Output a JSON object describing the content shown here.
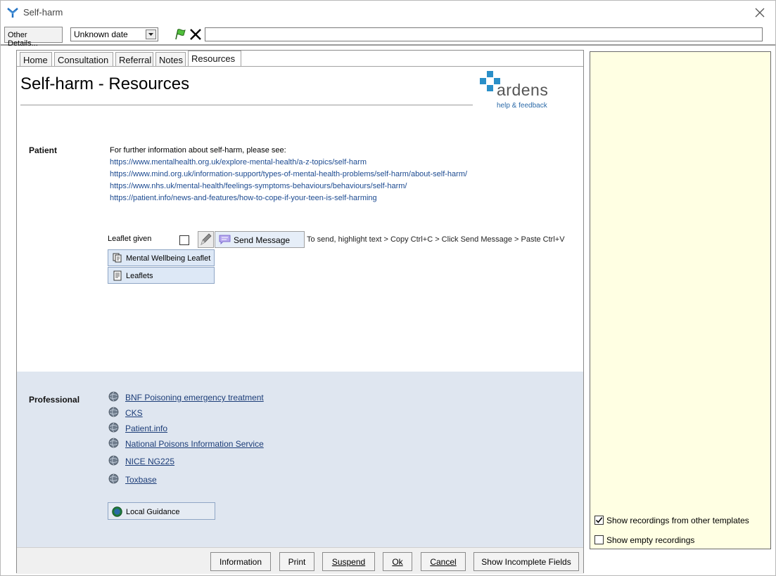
{
  "window": {
    "title": "Self-harm"
  },
  "toolbar": {
    "other_details_label": "Other Details...",
    "date_value": "Unknown date",
    "free_text_value": ""
  },
  "tabs": [
    {
      "label": "Home",
      "active": false
    },
    {
      "label": "Consultation",
      "active": false
    },
    {
      "label": "Referral",
      "active": false
    },
    {
      "label": "Notes",
      "active": false
    },
    {
      "label": "Resources",
      "active": true
    }
  ],
  "page": {
    "title": "Self-harm - Resources",
    "logo_word": "ardens",
    "logo_help": "help & feedback"
  },
  "patient": {
    "label": "Patient",
    "intro": "For further information about self-harm, please see:",
    "links": [
      "https://www.mentalhealth.org.uk/explore-mental-health/a-z-topics/self-harm",
      "https://www.mind.org.uk/information-support/types-of-mental-health-problems/self-harm/about-self-harm/",
      "https://www.nhs.uk/mental-health/feelings-symptoms-behaviours/behaviours/self-harm/",
      "https://patient.info/news-and-features/how-to-cope-if-your-teen-is-self-harming"
    ],
    "leaflet_given_label": "Leaflet given",
    "leaflet_given_checked": false,
    "send_message_label": "Send Message",
    "send_hint": "To send, highlight text > Copy Ctrl+C > Click Send Message > Paste Ctrl+V",
    "mental_leaflet_label": "Mental Wellbeing Leaflet",
    "leaflets_label": "Leaflets"
  },
  "professional": {
    "label": "Professional",
    "links": [
      "BNF Poisoning emergency treatment",
      "CKS",
      "Patient.info",
      "National Poisons Information Service",
      "NICE NG225",
      "Toxbase"
    ],
    "local_guidance_label": "Local Guidance"
  },
  "buttons": {
    "information": "Information",
    "print": "Print",
    "suspend": "Suspend",
    "ok": "Ok",
    "cancel": "Cancel",
    "show_incomplete": "Show Incomplete Fields"
  },
  "right_panel": {
    "show_other_templates_label": "Show recordings from other templates",
    "show_other_templates_checked": true,
    "show_empty_label": "Show empty recordings",
    "show_empty_checked": false
  },
  "colors": {
    "accent_blue": "#2b6aa8",
    "professional_bg": "#dfe6f0",
    "right_panel_bg": "#ffffe3",
    "link_blue": "#1c4a90"
  }
}
